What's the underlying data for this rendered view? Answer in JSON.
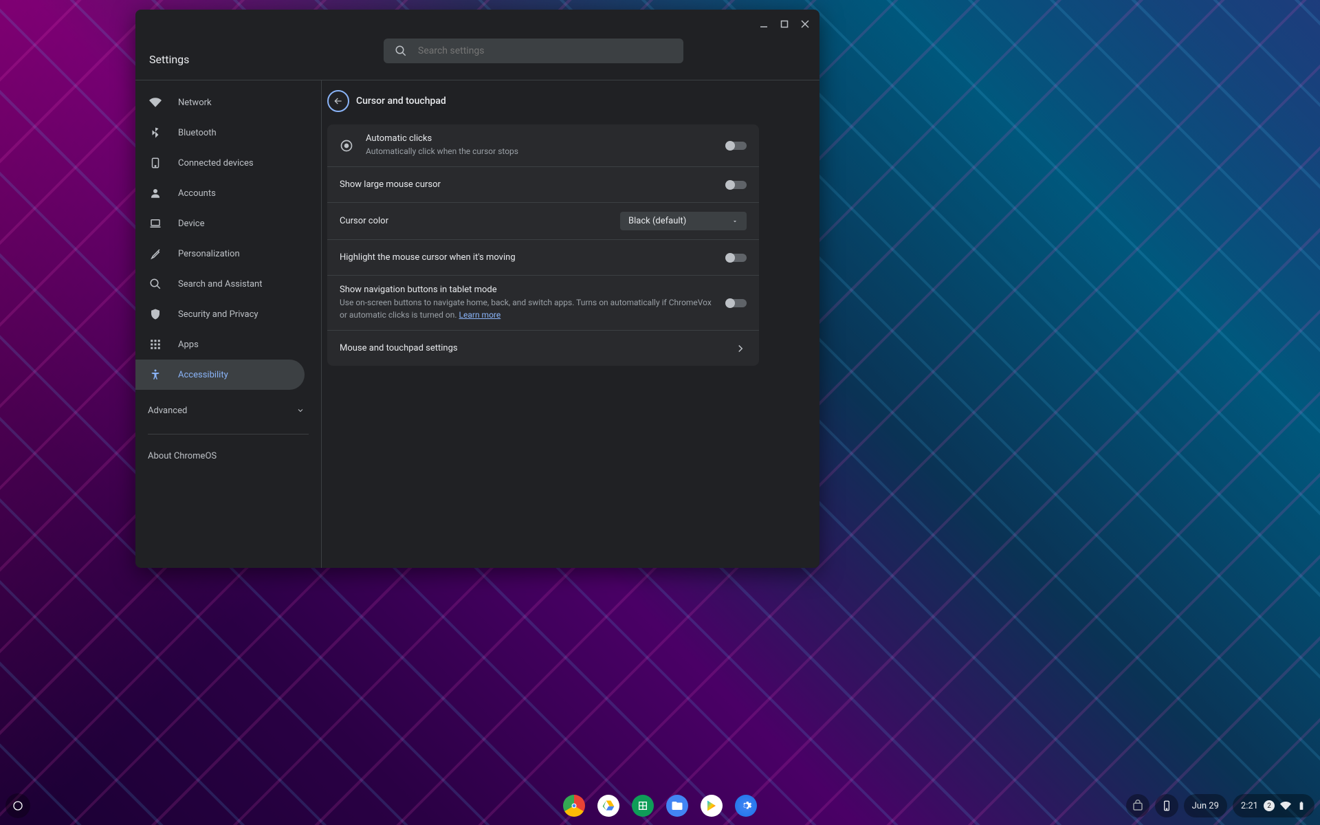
{
  "window": {
    "title": "Settings"
  },
  "search": {
    "placeholder": "Search settings"
  },
  "sidebar": {
    "items": [
      {
        "label": "Network"
      },
      {
        "label": "Bluetooth"
      },
      {
        "label": "Connected devices"
      },
      {
        "label": "Accounts"
      },
      {
        "label": "Device"
      },
      {
        "label": "Personalization"
      },
      {
        "label": "Search and Assistant"
      },
      {
        "label": "Security and Privacy"
      },
      {
        "label": "Apps"
      },
      {
        "label": "Accessibility"
      }
    ],
    "advanced": "Advanced",
    "about": "About ChromeOS"
  },
  "page": {
    "title": "Cursor and touchpad",
    "rows": {
      "autoclick": {
        "title": "Automatic clicks",
        "sub": "Automatically click when the cursor stops"
      },
      "large_cursor": {
        "title": "Show large mouse cursor"
      },
      "cursor_color": {
        "label": "Cursor color",
        "value": "Black (default)"
      },
      "highlight": {
        "title": "Highlight the mouse cursor when it's moving"
      },
      "nav_buttons": {
        "title": "Show navigation buttons in tablet mode",
        "sub": "Use on-screen buttons to navigate home, back, and switch apps. Turns on automatically if ChromeVox or automatic clicks is turned on. ",
        "learn": "Learn more"
      },
      "mouse_touchpad": {
        "title": "Mouse and touchpad settings"
      }
    }
  },
  "shelf": {
    "date": "Jun 29",
    "time": "2:21",
    "notif_count": "2"
  }
}
